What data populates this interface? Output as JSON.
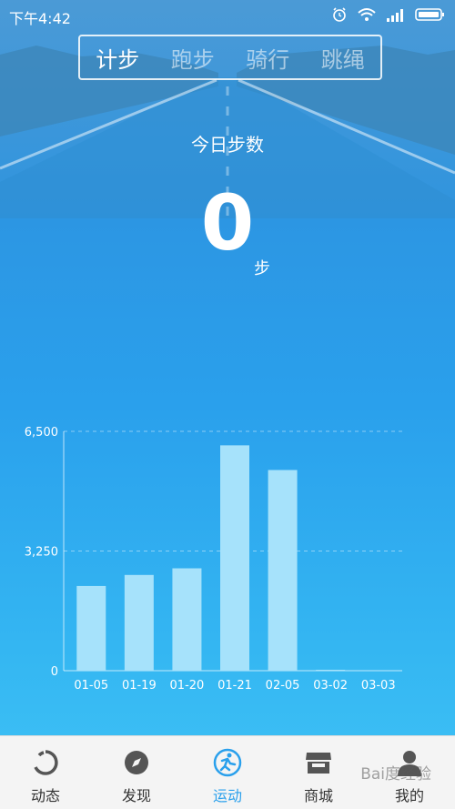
{
  "status_bar": {
    "time": "下午4:42"
  },
  "mode_tabs": [
    {
      "label": "计步",
      "active": true
    },
    {
      "label": "跑步",
      "active": false
    },
    {
      "label": "骑行",
      "active": false
    },
    {
      "label": "跳绳",
      "active": false
    }
  ],
  "today": {
    "label": "今日步数",
    "steps": "0",
    "unit": "步"
  },
  "chart_data": {
    "type": "bar",
    "categories": [
      "01-05",
      "01-19",
      "01-20",
      "01-21",
      "02-05",
      "03-02",
      "03-03"
    ],
    "values": [
      2300,
      2600,
      2780,
      6120,
      5450,
      20,
      0
    ],
    "ylim": [
      0,
      6500
    ],
    "yticks": [
      "0",
      "3,250",
      "6,500"
    ],
    "grid": true,
    "bar_color": "#a6e2fb"
  },
  "tab_bar": [
    {
      "label": "动态",
      "icon": "feed-icon",
      "active": false
    },
    {
      "label": "发现",
      "icon": "compass-icon",
      "active": false
    },
    {
      "label": "运动",
      "icon": "run-icon",
      "active": true
    },
    {
      "label": "商城",
      "icon": "shop-icon",
      "active": false
    },
    {
      "label": "我的",
      "icon": "profile-icon",
      "active": false
    }
  ],
  "watermark": "Bai度经验",
  "colors": {
    "accent": "#2aa0ec",
    "tab_inactive": "#333333"
  }
}
